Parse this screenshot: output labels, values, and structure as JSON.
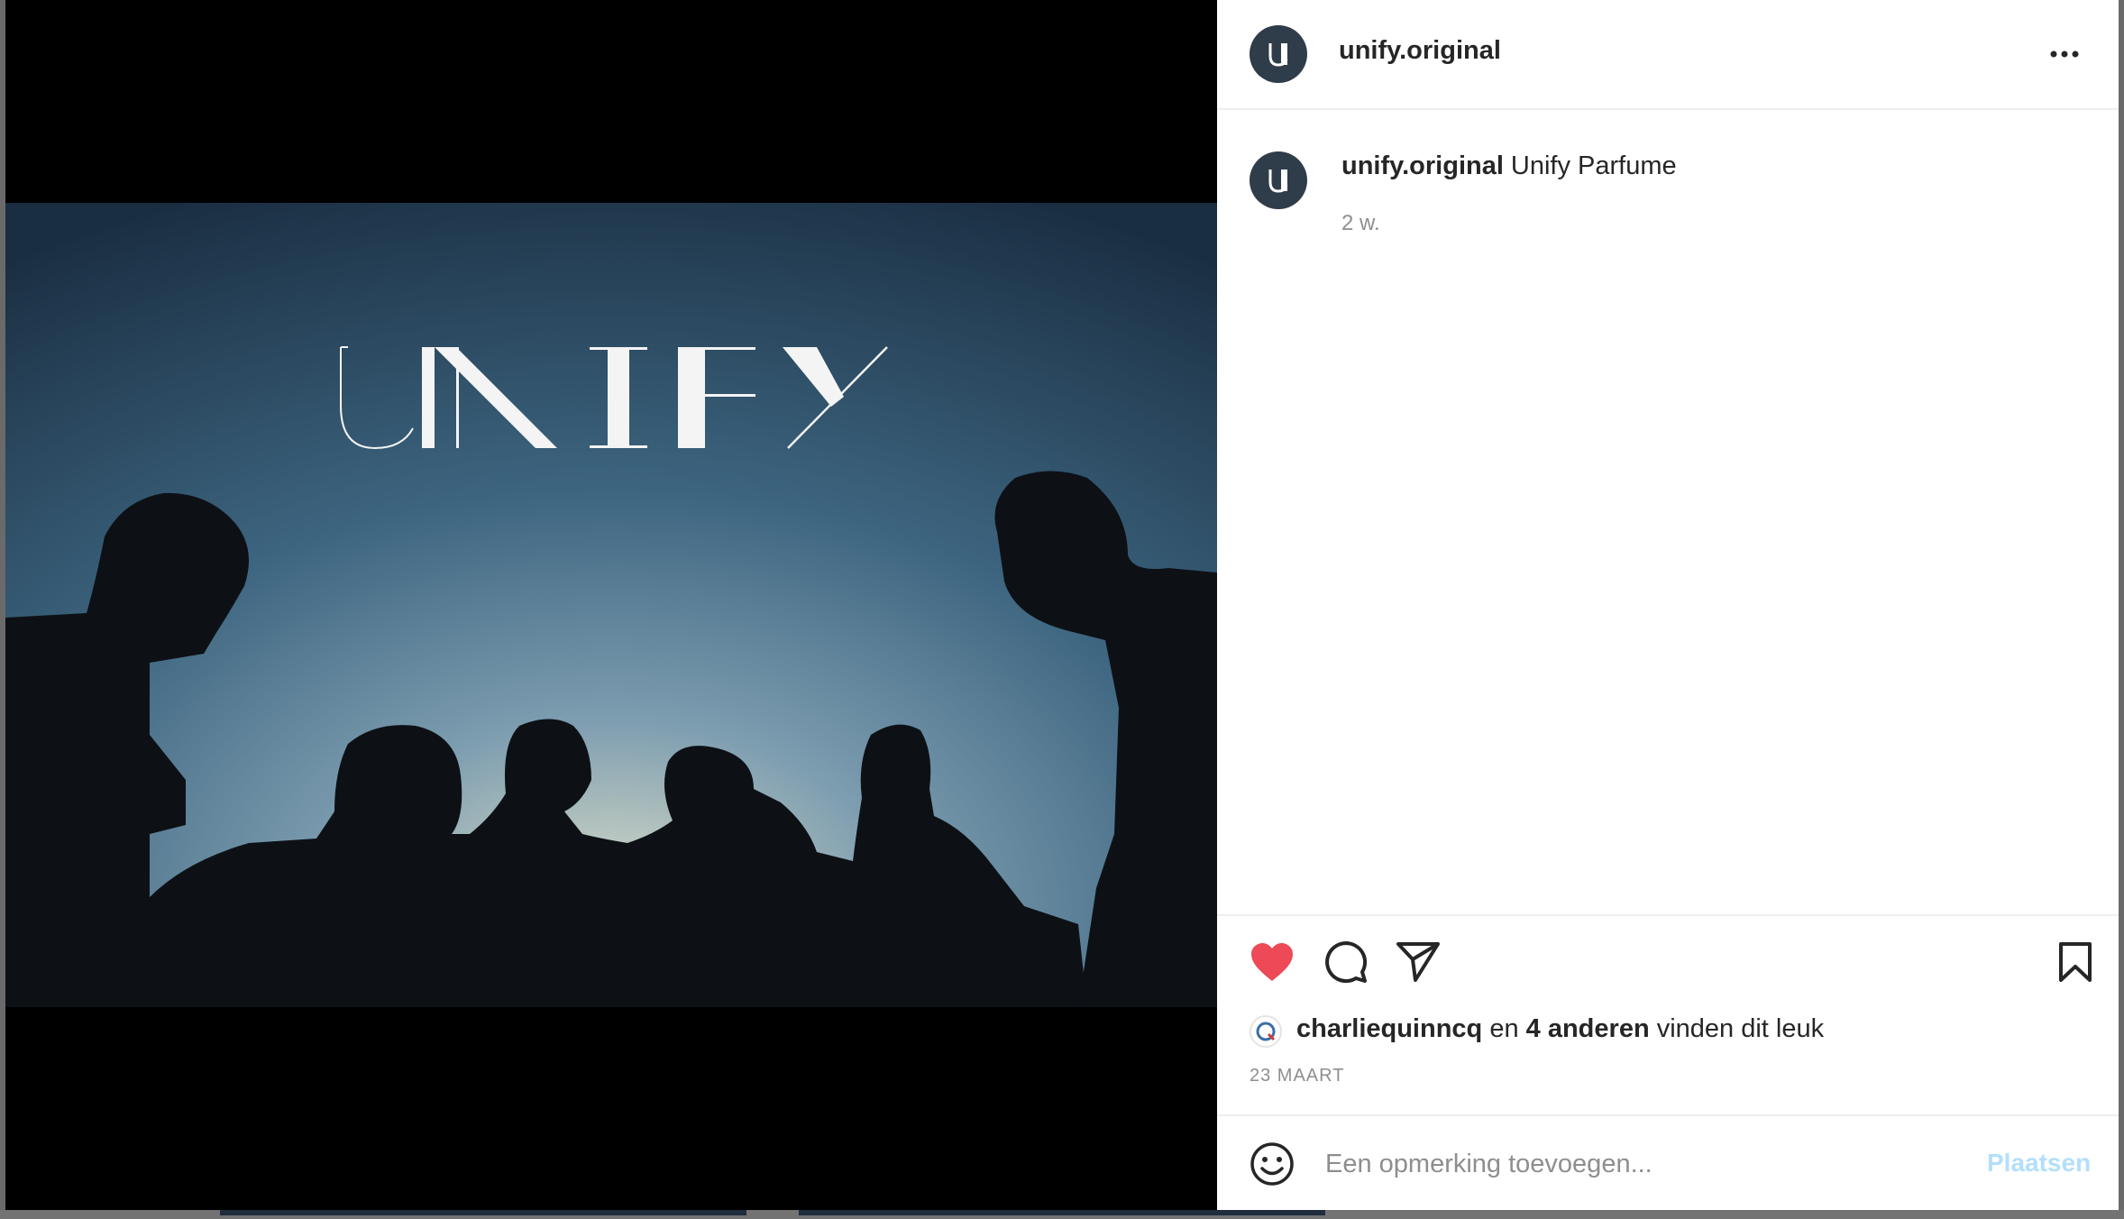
{
  "post": {
    "username": "unify.original",
    "caption_user": "unify.original",
    "caption_text": "Unify Parfume",
    "time_ago": "2 w.",
    "brand_logo_text": "UNIFY",
    "likes": {
      "first_liker": "charliequinncq",
      "connector": "en",
      "others": "4 anderen",
      "suffix": "vinden dit leuk"
    },
    "date": "23 MAART",
    "comment_placeholder": "Een opmerking toevoegen...",
    "post_button": "Plaatsen",
    "liked": true
  },
  "icons": [
    "more-options-icon",
    "heart-icon",
    "comment-icon",
    "share-icon",
    "bookmark-icon",
    "emoji-icon",
    "avatar-logo-icon"
  ],
  "colors": {
    "heart": "#ed4956",
    "post_button_disabled": "#b2dffc",
    "avatar_bg": "#2f3c4a",
    "sky_top": "#1b3044",
    "sky_glow": "#d8dcc8"
  }
}
